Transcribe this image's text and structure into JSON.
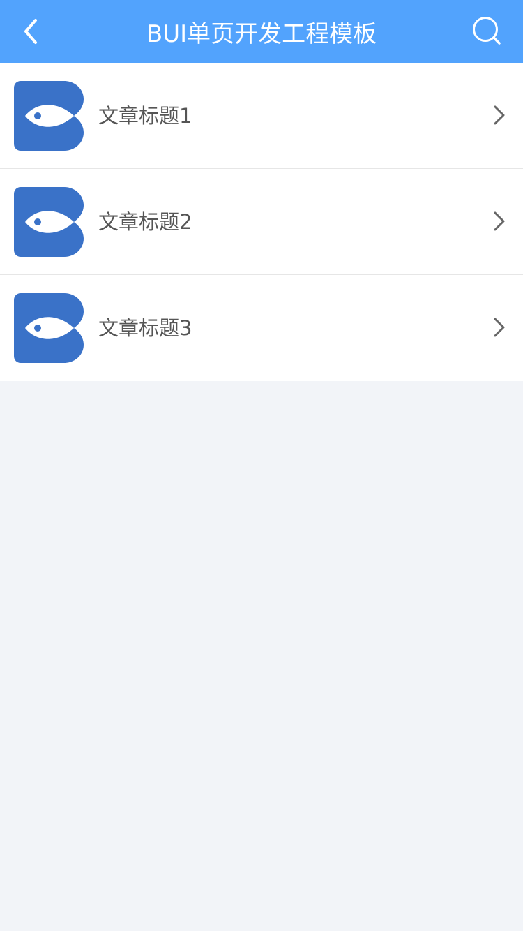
{
  "header": {
    "title": "BUI单页开发工程模板",
    "background_color": "#52a3fd",
    "back_icon": "chevron-left-icon",
    "search_icon": "search-icon"
  },
  "list": {
    "items": [
      {
        "title": "文章标题1",
        "thumbnail_icon": "bui-fish-logo-icon"
      },
      {
        "title": "文章标题2",
        "thumbnail_icon": "bui-fish-logo-icon"
      },
      {
        "title": "文章标题3",
        "thumbnail_icon": "bui-fish-logo-icon"
      }
    ]
  },
  "colors": {
    "accent": "#52a3fd",
    "logo_blue": "#3a72c8",
    "page_background": "#f2f4f8"
  }
}
